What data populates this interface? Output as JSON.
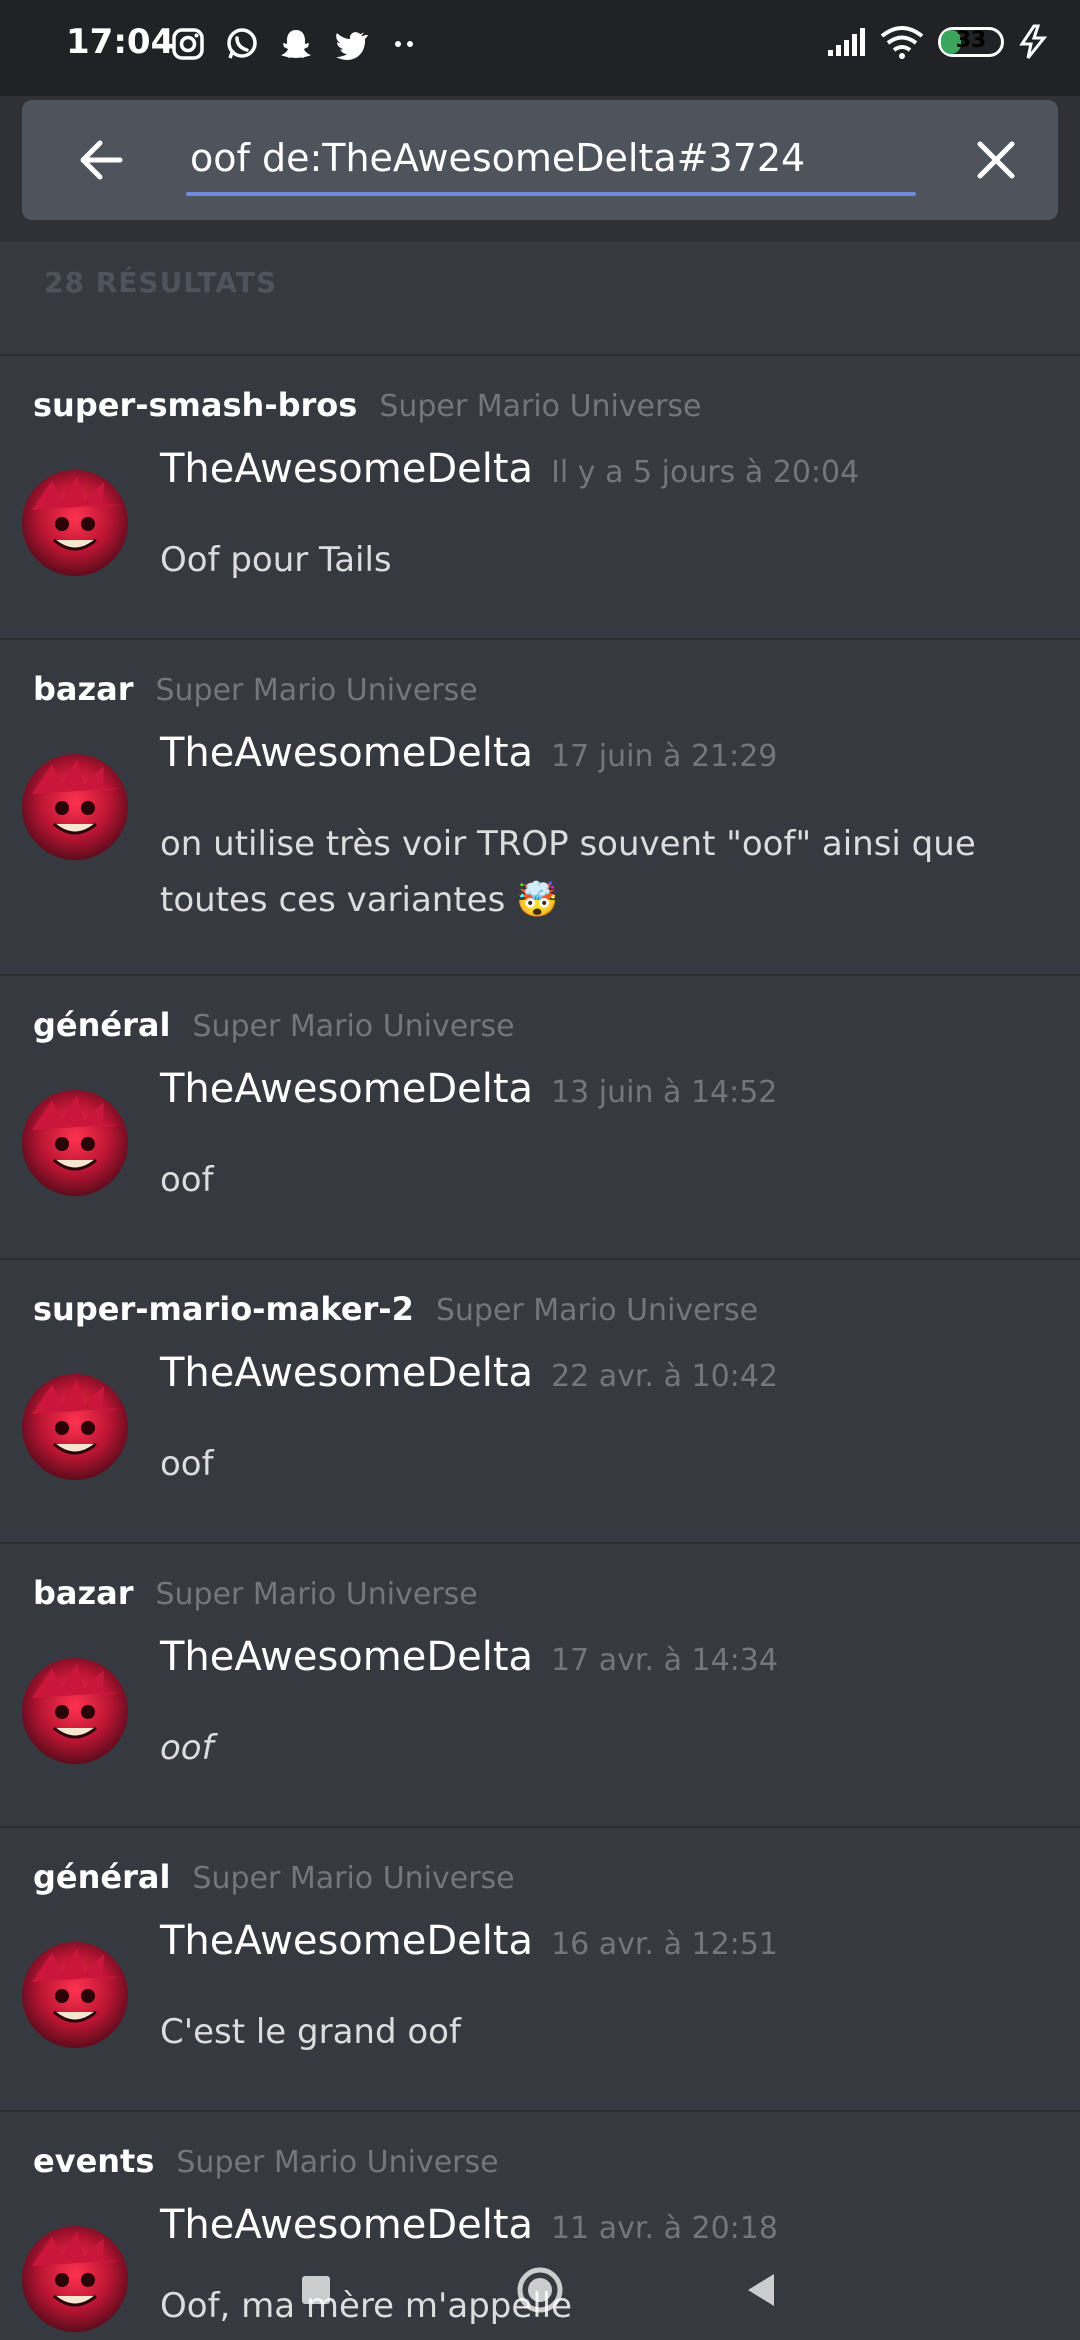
{
  "status_bar": {
    "time": "17:04",
    "left_icons": [
      "instagram-icon",
      "whatsapp-icon",
      "snapchat-icon",
      "twitter-icon",
      "more-dots-icon"
    ],
    "battery": "33",
    "battery_level_percent": 33
  },
  "search": {
    "query": "oof de:TheAwesomeDelta#3724",
    "accent_color": "#7289da"
  },
  "results_count": "28 RÉSULTATS",
  "results": [
    {
      "channel": "super-smash-bros",
      "guild": "Super Mario Universe",
      "author": "TheAwesomeDelta",
      "time": "Il y a 5 jours à 20:04",
      "text": "Oof pour Tails"
    },
    {
      "channel": "bazar",
      "guild": "Super Mario Universe",
      "author": "TheAwesomeDelta",
      "time": "17 juin à 21:29",
      "text": "on utilise très voir TROP souvent \"oof\" ainsi que toutes ces variantes 🤯"
    },
    {
      "channel": "général",
      "guild": "Super Mario Universe",
      "author": "TheAwesomeDelta",
      "time": "13 juin à 14:52",
      "text": "oof"
    },
    {
      "channel": "super-mario-maker-2",
      "guild": "Super Mario Universe",
      "author": "TheAwesomeDelta",
      "time": "22 avr. à 10:42",
      "text": "oof"
    },
    {
      "channel": "bazar",
      "guild": "Super Mario Universe",
      "author": "TheAwesomeDelta",
      "time": "17 avr. à 14:34",
      "text": "oof"
    },
    {
      "channel": "général",
      "guild": "Super Mario Universe",
      "author": "TheAwesomeDelta",
      "time": "16 avr. à 12:51",
      "text": "C'est le grand oof"
    },
    {
      "channel": "events",
      "guild": "Super Mario Universe",
      "author": "TheAwesomeDelta",
      "time": "11 avr. à 20:18",
      "text": "Oof, ma mère m'appelle"
    }
  ]
}
